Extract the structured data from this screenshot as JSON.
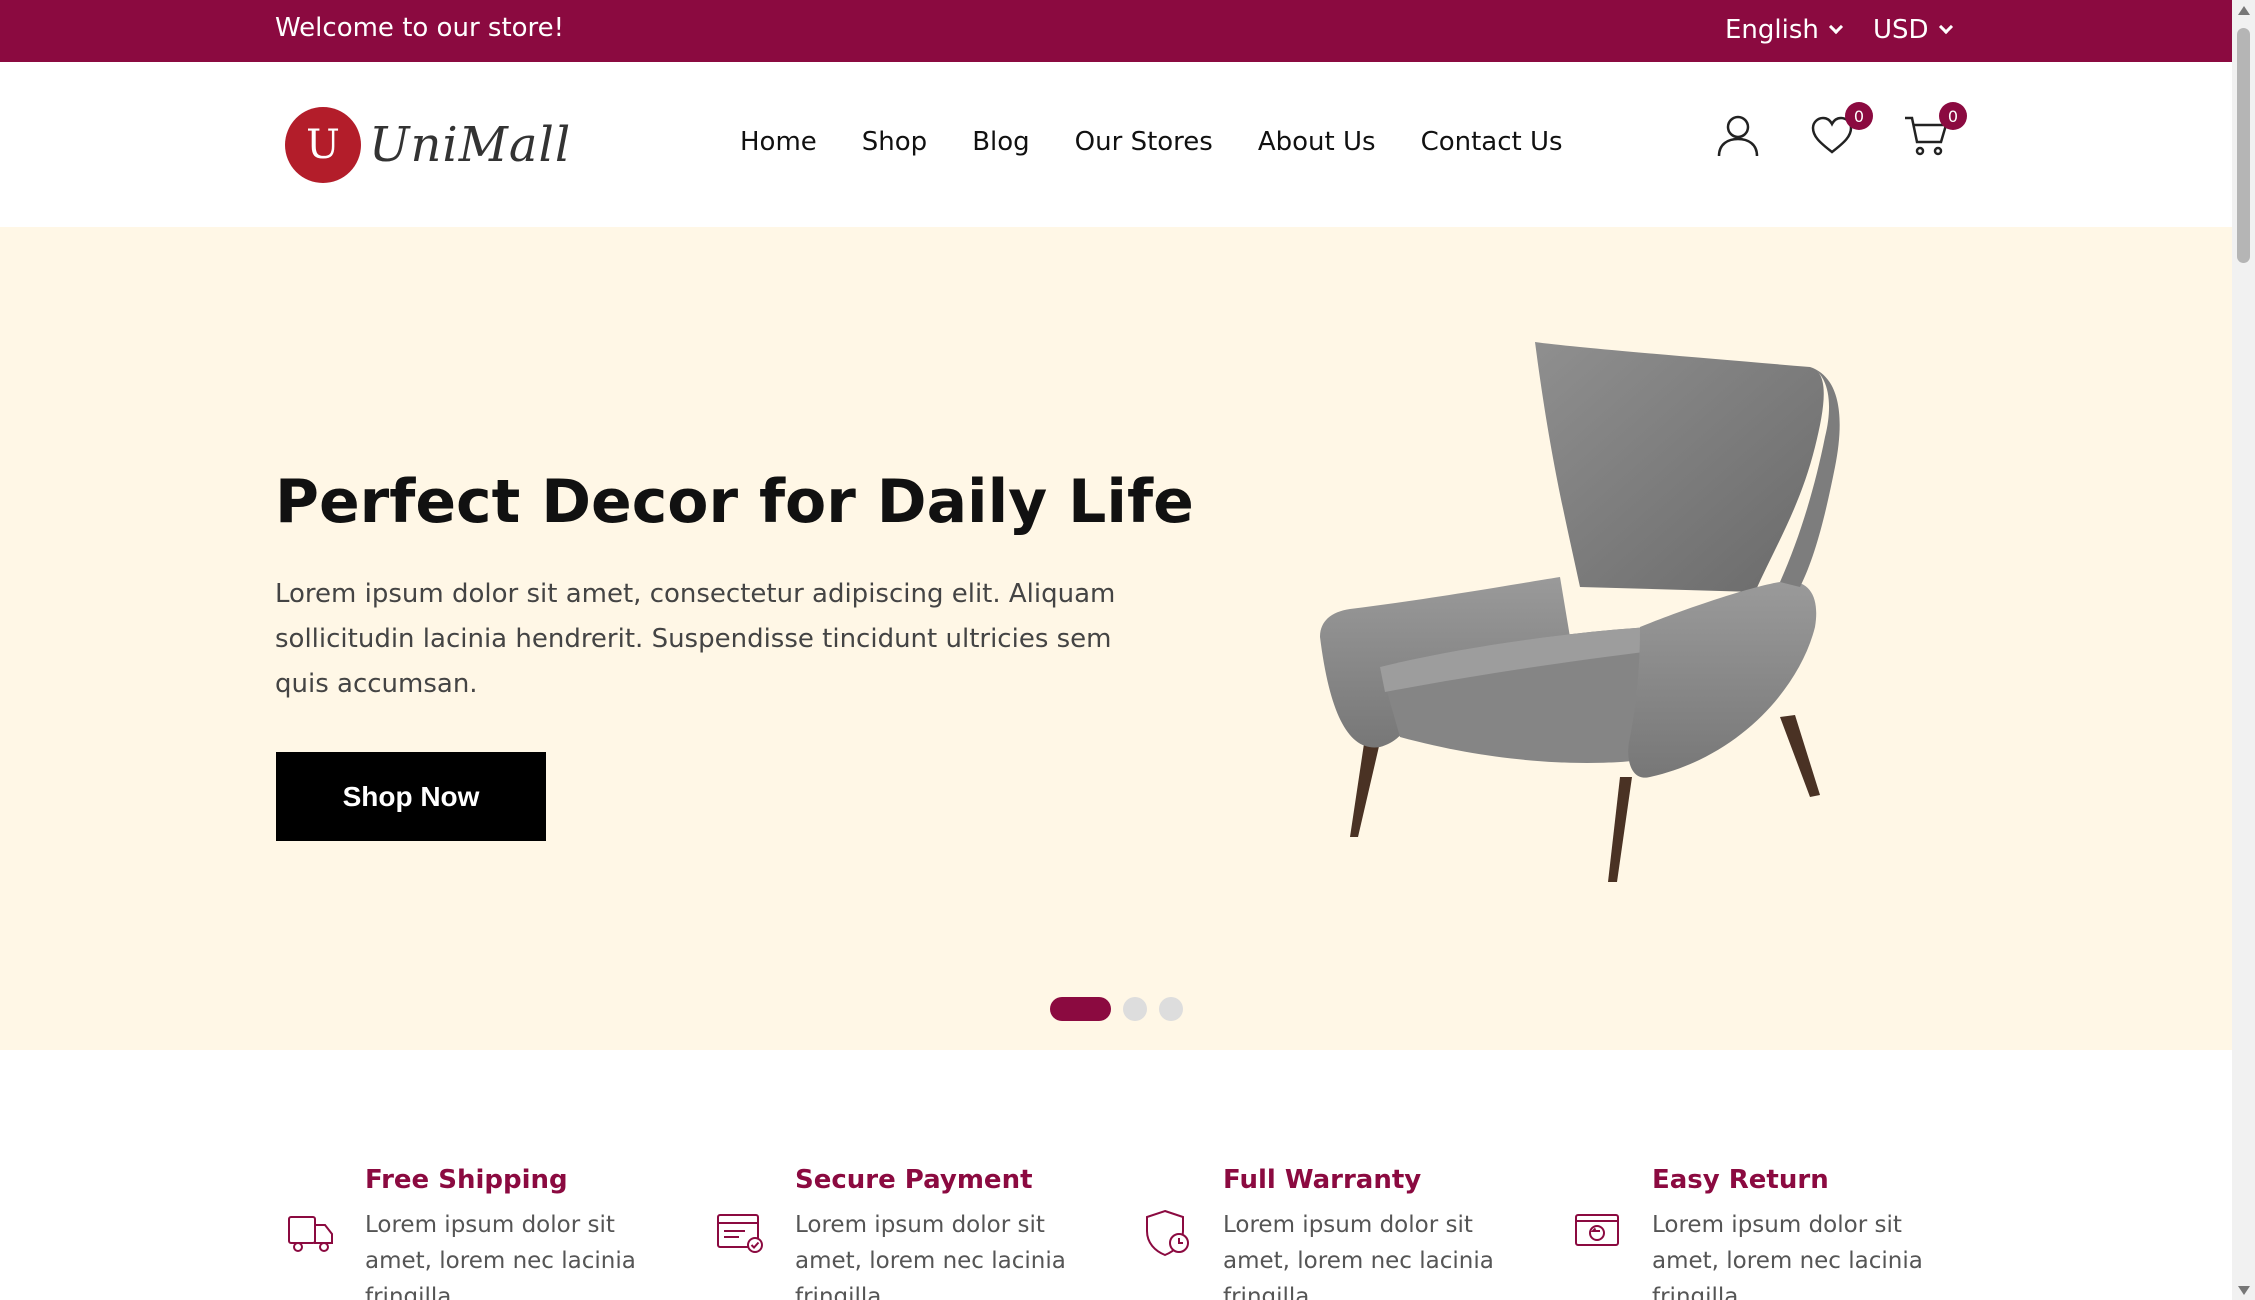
{
  "topbar": {
    "welcome": "Welcome to our store!",
    "language": "English",
    "currency": "USD"
  },
  "header": {
    "logo_letter": "U",
    "logo_text": "UniMall",
    "nav": [
      "Home",
      "Shop",
      "Blog",
      "Our Stores",
      "About Us",
      "Contact Us"
    ],
    "wishlist_count": "0",
    "cart_count": "0"
  },
  "hero": {
    "title": "Perfect Decor for Daily Life",
    "text": "Lorem ipsum dolor sit amet, consectetur adipiscing elit. Aliquam sollicitudin lacinia hendrerit. Suspendisse tincidunt ultricies sem quis accumsan.",
    "button": "Shop Now",
    "slides_total": 3,
    "active_slide": 1
  },
  "features": [
    {
      "icon": "truck-icon",
      "title": "Free Shipping",
      "text": "Lorem ipsum dolor sit amet, lorem nec lacinia fringilla."
    },
    {
      "icon": "card-check-icon",
      "title": "Secure Payment",
      "text": "Lorem ipsum dolor sit amet, lorem nec lacinia fringilla."
    },
    {
      "icon": "shield-clock-icon",
      "title": "Full Warranty",
      "text": "Lorem ipsum dolor sit amet, lorem nec lacinia fringilla."
    },
    {
      "icon": "return-box-icon",
      "title": "Easy Return",
      "text": "Lorem ipsum dolor sit amet, lorem nec lacinia fringilla."
    }
  ],
  "colors": {
    "brand": "#8b0a40",
    "hero_bg": "#fff7e6",
    "logo_red": "#b31d2a"
  }
}
